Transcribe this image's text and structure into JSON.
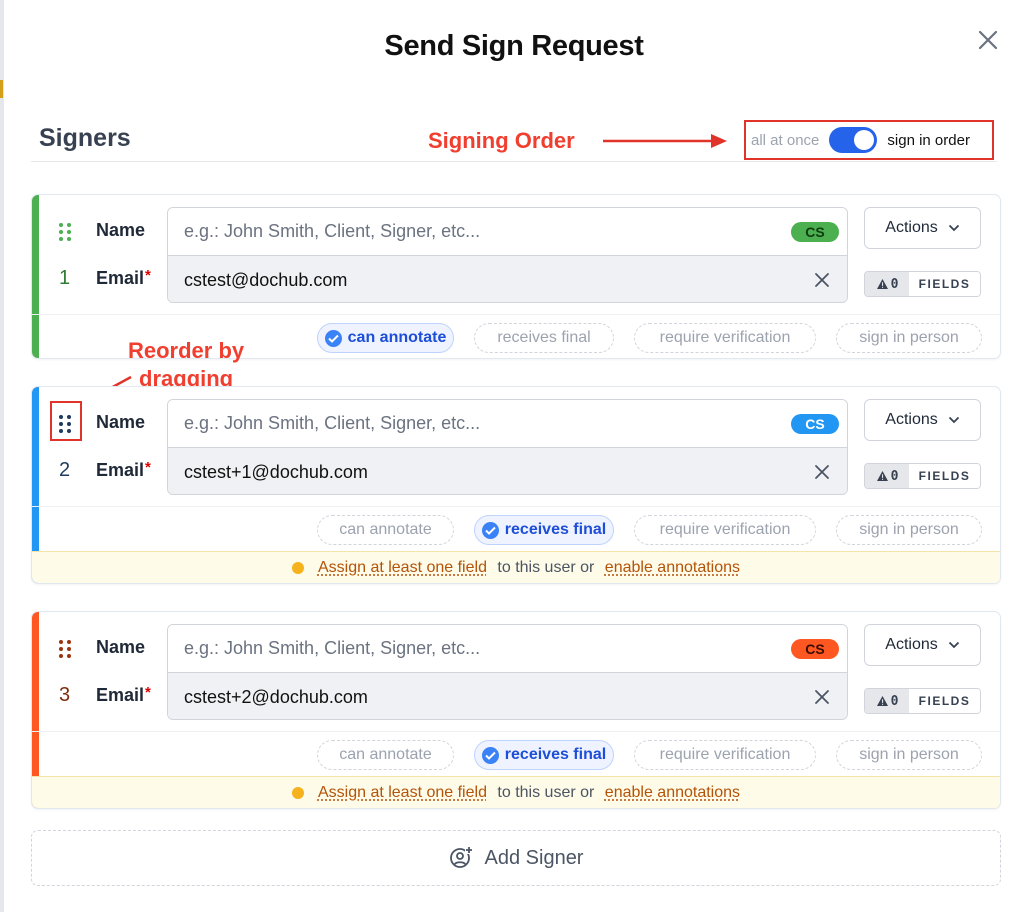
{
  "modal": {
    "title": "Send Sign Request"
  },
  "signers_section": {
    "title": "Signers",
    "order_toggle": {
      "left_label": "all at once",
      "right_label": "sign in order",
      "state": "sign in order"
    }
  },
  "annotations": {
    "signing_order": "Signing Order",
    "reorder": [
      "Reorder by",
      "dragging"
    ]
  },
  "labels": {
    "name": "Name",
    "email": "Email",
    "required_mark": "*"
  },
  "common": {
    "name_placeholder": "e.g.: John Smith, Client, Signer, etc...",
    "actions_label": "Actions",
    "fields_label": "FIELDS",
    "fields_count": "0",
    "warning": {
      "link1": "Assign at least one field",
      "mid": " to this user or ",
      "link2": "enable annotations"
    },
    "options": [
      "can annotate",
      "receives final",
      "require verification",
      "sign in person"
    ]
  },
  "signers": [
    {
      "number": "1",
      "email": "cstest@dochub.com",
      "initials": "CS",
      "color": "#4caf50",
      "badge_text": "#0f3d12",
      "enabled_option": "can annotate",
      "warning": false
    },
    {
      "number": "2",
      "email": "cstest+1@dochub.com",
      "initials": "CS",
      "color": "#2196f3",
      "badge_text": "#ffffff",
      "enabled_option": "receives final",
      "warning": true
    },
    {
      "number": "3",
      "email": "cstest+2@dochub.com",
      "initials": "CS",
      "color": "#ff5722",
      "badge_text": "#3a0d00",
      "enabled_option": "receives final",
      "warning": true
    }
  ],
  "add_signer": {
    "label": "Add Signer",
    "icon": "add-user-icon"
  },
  "colors": {
    "accent_blue": "#2563eb",
    "annotation_red": "#f03e2f",
    "warning_bg": "#fefbe8"
  }
}
